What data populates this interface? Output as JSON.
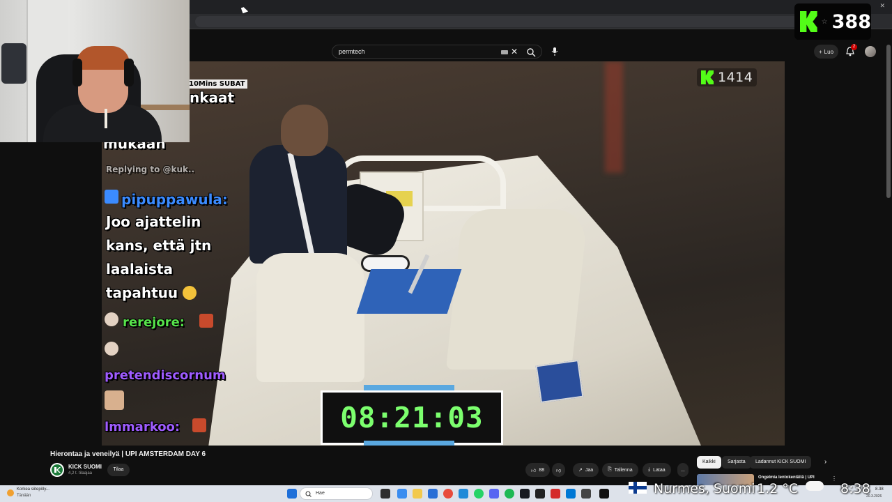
{
  "browser": {
    "window_controls": [
      "–",
      "□",
      "✕"
    ]
  },
  "header": {
    "search_value": "permtech",
    "create_label": "Luo",
    "notification_count": "2"
  },
  "stream_overlay": {
    "kick_followers_top": "388",
    "kick_viewers_video": "1414",
    "timer": "08:21:03",
    "sub_banner": "10Mins  SUBAT"
  },
  "chat": {
    "fragments": [
      "nkaat",
      "mukaan",
      "Replying to @kuk.."
    ],
    "users": [
      "pipuppawula:",
      "rerejore:",
      "pretendiscornum",
      "lmmarkoo:"
    ],
    "message": [
      "Joo ajattelin",
      "kans, että jtn",
      "laalaista",
      "tapahtuu"
    ]
  },
  "video": {
    "title": "Hierontaa ja veneilyä | UPI AMSTERDAM DAY 6",
    "channel_name": "KICK SUOMI",
    "subscribers": "4,2 t. tilaajaa",
    "subscribe_label": "Tilaa",
    "like_count": "88",
    "share_label": "Jaa",
    "save_label": "Tallenna",
    "download_label": "Lataa",
    "more_label": "..."
  },
  "chips": [
    "Kaikki",
    "Sarjasta",
    "Ladannut KICK SUOMI"
  ],
  "recommendation": {
    "title": "Ongelmia lentokentällä | UPI"
  },
  "taskbar": {
    "weather_line1": "Korkea siitepöly...",
    "weather_line2": "Tänään",
    "search_placeholder": "Hae",
    "clock": "8.38",
    "date": "20.3.2026"
  },
  "weather_overlay": {
    "location": "Nurmes, Suomi",
    "temperature": "1.2 °C",
    "time": "8:38"
  },
  "colors": {
    "kick_green": "#53fc18",
    "timer_green": "#7cff6e",
    "youtube_bg": "#0f0f0f"
  }
}
